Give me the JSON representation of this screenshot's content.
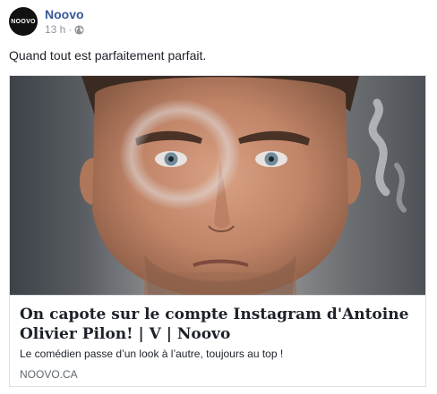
{
  "page": {
    "name": "Noovo",
    "avatar_text": "NOOVO",
    "timestamp": "13 h",
    "separator": "·",
    "privacy_icon": "globe-icon"
  },
  "post": {
    "text": "Quand tout est parfaitement parfait."
  },
  "link_card": {
    "image": "portrait-photo",
    "title": "On capote sur le compte Instagram d'Antoine Olivier Pilon! | V | Noovo",
    "description": "Le comédien passe d’un look à l’autre, toujours au top !",
    "domain": "NOOVO.CA"
  },
  "colors": {
    "page_name": "#385898",
    "meta_text": "#90949c",
    "border": "#dddfe2"
  }
}
